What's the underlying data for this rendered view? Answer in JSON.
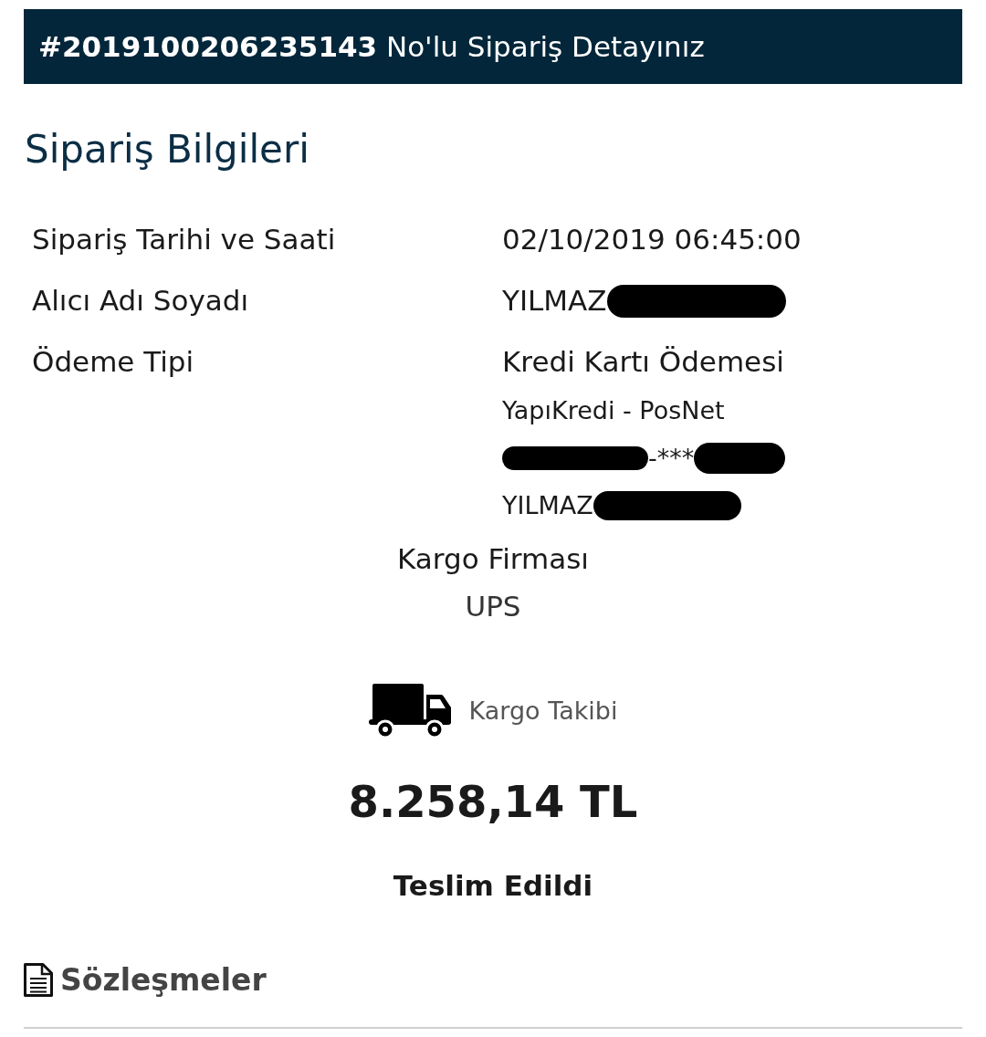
{
  "header": {
    "title": "**#2019100206235143** No'lu Sipariş Detayınız"
  },
  "order_info": {
    "title": "Sipariş Bilgileri",
    "rows": [
      {
        "label": "Sipariş Tarihi ve Saati",
        "value": [
          {
            "kind": "text",
            "text": "02/10/2019 06:45:00"
          }
        ]
      },
      {
        "label": "Alıcı Adı Soyadı",
        "value": [
          {
            "kind": "text",
            "text": "YILMAZ"
          },
          {
            "kind": "redaction"
          }
        ]
      },
      {
        "label": "Ödeme Tipi",
        "value": [
          {
            "kind": "text",
            "text": "Kredi Kartı Ödemesi"
          }
        ],
        "details": [
          [
            {
              "kind": "text",
              "text": "YapıKredi - PosNet"
            }
          ],
          [
            {
              "kind": "redaction"
            },
            {
              "kind": "text",
              "text": "-***"
            },
            {
              "kind": "redaction"
            }
          ],
          [
            {
              "kind": "text",
              "text": "YILMAZ"
            },
            {
              "kind": "redaction"
            }
          ]
        ]
      }
    ]
  },
  "shipping": {
    "label": "Kargo Firması",
    "company": "UPS",
    "tracking_link": "Kargo Takibi"
  },
  "total": "8.258,14 TL",
  "order_status": "Teslim Edildi",
  "contracts": {
    "label": "Sözleşmeler"
  }
}
